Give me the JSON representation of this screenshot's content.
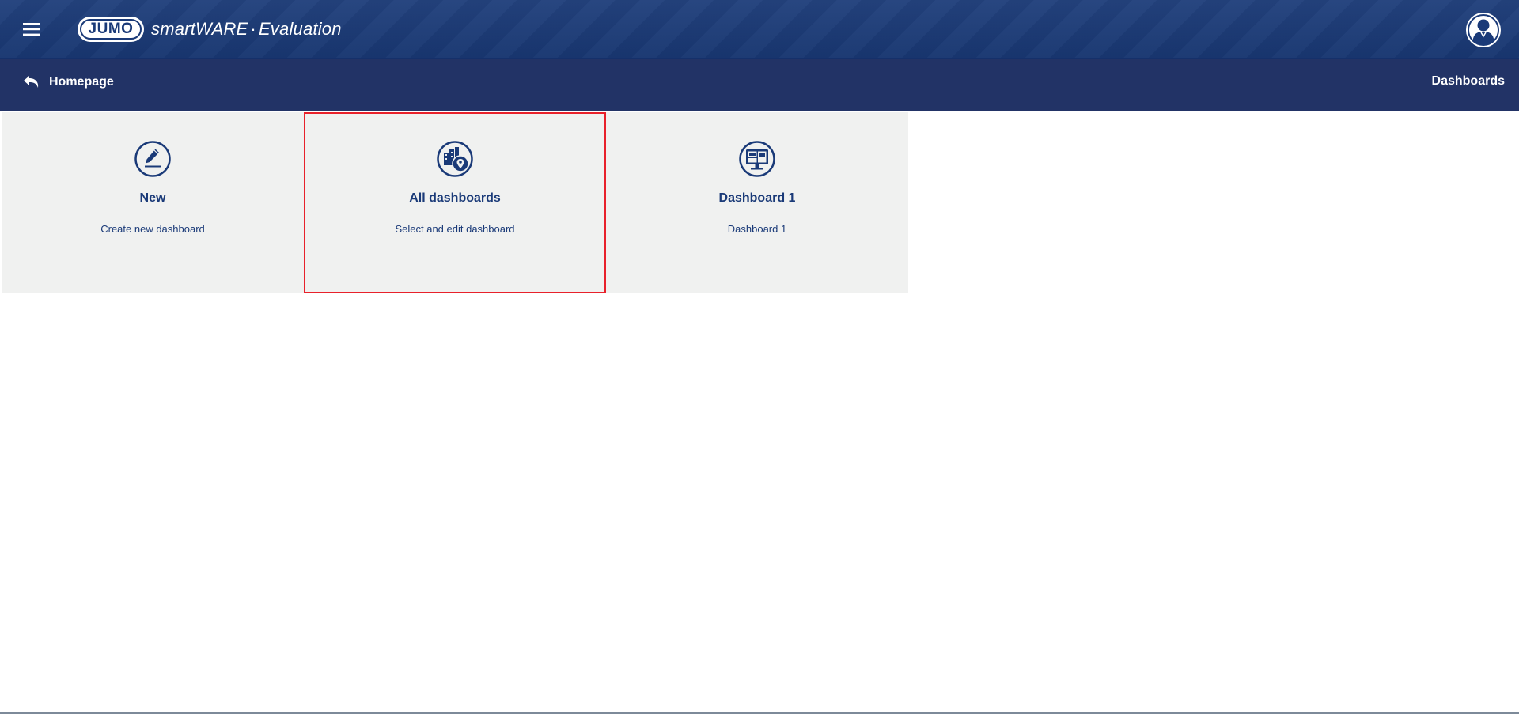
{
  "header": {
    "brand_badge": "JUMO",
    "app_name": "smartWARE",
    "app_separator": "·",
    "app_module": "Evaluation",
    "menu_icon": "hamburger-menu-icon",
    "user_icon": "user-avatar-icon"
  },
  "nav": {
    "back_label": "Homepage",
    "back_icon": "back-arrow-icon",
    "section_title": "Dashboards"
  },
  "tiles": [
    {
      "title": "New",
      "subtitle": "Create new dashboard",
      "icon": "pencil-edit-icon",
      "selected": false
    },
    {
      "title": "All dashboards",
      "subtitle": "Select and edit dashboard",
      "icon": "dashboards-collection-icon",
      "selected": true
    },
    {
      "title": "Dashboard 1",
      "subtitle": "Dashboard 1",
      "icon": "monitor-dashboard-icon",
      "selected": false
    }
  ],
  "colors": {
    "header_bg": "#1a3a78",
    "nav_bg": "#223366",
    "tile_bg": "#f0f1f0",
    "tile_text": "#1a3a78",
    "selection_border": "#e8212b"
  }
}
